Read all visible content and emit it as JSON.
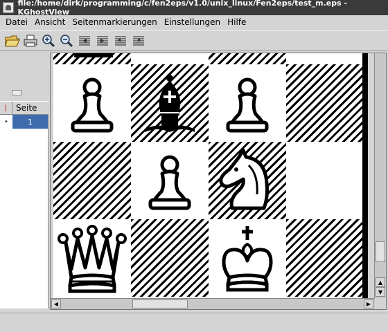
{
  "window": {
    "title": "file:/home/dirk/programming/c/fen2eps/v1.0/unix_linux/Fen2eps/test_m.eps - KGhostView"
  },
  "menu": [
    "Datei",
    "Ansicht",
    "Seitenmarkierungen",
    "Einstellungen",
    "Hilfe"
  ],
  "toolbar": {
    "buttons": [
      "open-icon",
      "print-icon",
      "zoom-in-icon",
      "zoom-out-icon",
      "prev-page-icon",
      "next-page-icon",
      "first-page-icon",
      "last-page-icon"
    ]
  },
  "page_list": {
    "header_mark": "❘",
    "header_label": "Seite",
    "rows": [
      {
        "bullet": "•",
        "page": "1"
      }
    ]
  },
  "board": {
    "pieces": [
      {
        "piece": "pawn",
        "color": "white"
      },
      {
        "piece": "bishop",
        "color": "black"
      },
      {
        "piece": "pawn",
        "color": "white"
      },
      {
        "piece": "pawn",
        "color": "white"
      },
      {
        "piece": "knight",
        "color": "white"
      },
      {
        "piece": "queen",
        "color": "white"
      },
      {
        "piece": "king",
        "color": "white"
      }
    ]
  }
}
